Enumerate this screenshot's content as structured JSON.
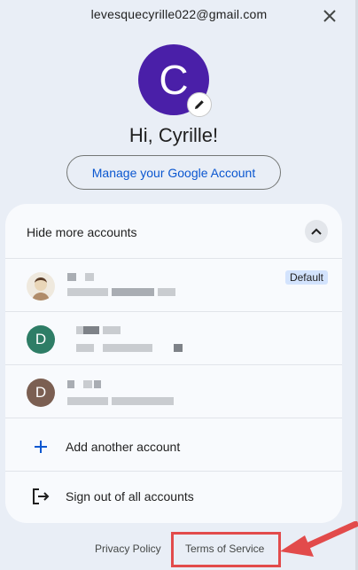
{
  "header": {
    "email": "levesquecyrille022@gmail.com",
    "avatar_letter": "C",
    "greeting": "Hi, Cyrille!",
    "manage_label": "Manage your Google Account"
  },
  "accounts_card": {
    "hide_label": "Hide more accounts",
    "default_badge": "Default",
    "accounts": [
      {
        "avatar": ""
      },
      {
        "avatar": "D"
      },
      {
        "avatar": "D"
      }
    ],
    "add_label": "Add another account",
    "signout_label": "Sign out of all accounts"
  },
  "footer": {
    "privacy_label": "Privacy Policy",
    "tos_label": "Terms of Service"
  },
  "colors": {
    "accent": "#0b57d0",
    "avatar_main": "#4a1fa8",
    "avatar_green": "#2e7d66",
    "avatar_brown": "#7b5f52",
    "highlight": "#e24b4b"
  }
}
